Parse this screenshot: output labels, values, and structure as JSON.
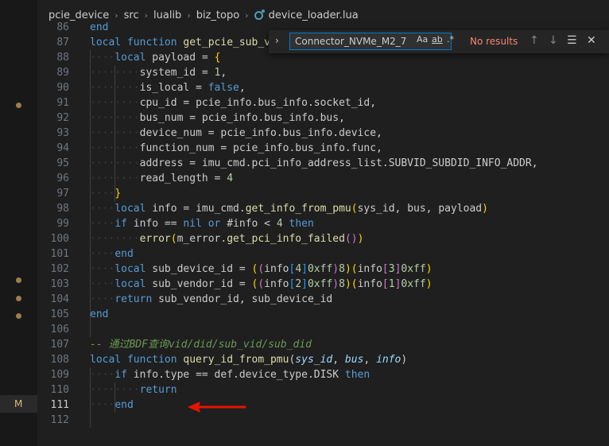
{
  "breadcrumb": {
    "items": [
      "pcie_device",
      "src",
      "lualib",
      "biz_topo",
      "device_loader.lua"
    ],
    "separator": "›"
  },
  "find": {
    "query": "Connector_NVMe_M2_7",
    "match_case_label": "Aa",
    "whole_word_label": "ab",
    "regex_label": ".*",
    "status": "No results",
    "toggle_icon": "chevron-right-icon",
    "prev_icon": "arrow-up-icon",
    "next_icon": "arrow-down-icon",
    "selection_icon": "find-in-selection-icon",
    "close_icon": "close-icon"
  },
  "gutter": {
    "modified_label": "M"
  },
  "lines": [
    {
      "n": "86",
      "tokens": [
        [
          "kw",
          "end"
        ]
      ]
    },
    {
      "n": "87",
      "tokens": [
        [
          "kw",
          "local function "
        ],
        [
          "fn",
          "get_pcie_sub_vid_did_info"
        ],
        [
          "",
          "("
        ],
        [
          "param",
          "sys_id"
        ],
        [
          "",
          ", "
        ],
        [
          "param",
          "bus"
        ],
        [
          "",
          ", "
        ],
        [
          "param",
          "pcie_info"
        ],
        [
          "",
          ")"
        ]
      ]
    },
    {
      "n": "88",
      "tokens": [
        [
          "ws",
          "····"
        ],
        [
          "kw",
          "local "
        ],
        [
          "",
          "payload = "
        ],
        [
          "brace",
          "{"
        ]
      ]
    },
    {
      "n": "89",
      "tokens": [
        [
          "ws",
          "········"
        ],
        [
          "",
          "system_id = "
        ],
        [
          "num",
          "1"
        ],
        [
          "",
          ","
        ]
      ]
    },
    {
      "n": "90",
      "tokens": [
        [
          "ws",
          "········"
        ],
        [
          "",
          "is_local = "
        ],
        [
          "kw",
          "false"
        ],
        [
          "",
          ","
        ]
      ]
    },
    {
      "n": "91",
      "tokens": [
        [
          "ws",
          "········"
        ],
        [
          "",
          "cpu_id = pcie_info.bus_info.socket_id,"
        ]
      ]
    },
    {
      "n": "92",
      "tokens": [
        [
          "ws",
          "········"
        ],
        [
          "",
          "bus_num = pcie_info.bus_info.bus,"
        ]
      ]
    },
    {
      "n": "93",
      "tokens": [
        [
          "ws",
          "········"
        ],
        [
          "",
          "device_num = pcie_info.bus_info.device,"
        ]
      ]
    },
    {
      "n": "94",
      "tokens": [
        [
          "ws",
          "········"
        ],
        [
          "",
          "function_num = pcie_info.bus_info.func,"
        ]
      ]
    },
    {
      "n": "95",
      "tokens": [
        [
          "ws",
          "········"
        ],
        [
          "",
          "address = imu_cmd.pci_info_address_list.SUBVID_SUBDID_INFO_ADDR,"
        ]
      ]
    },
    {
      "n": "96",
      "tokens": [
        [
          "ws",
          "········"
        ],
        [
          "",
          "read_length = "
        ],
        [
          "num",
          "4"
        ]
      ]
    },
    {
      "n": "97",
      "tokens": [
        [
          "ws",
          "····"
        ],
        [
          "brace",
          "}"
        ]
      ]
    },
    {
      "n": "98",
      "tokens": [
        [
          "ws",
          "····"
        ],
        [
          "kw",
          "local "
        ],
        [
          "",
          "info = imu_cmd."
        ],
        [
          "fn",
          "get_info_from_pmu"
        ],
        [
          "brace",
          "("
        ],
        [
          "",
          "sys_id, bus, payload"
        ],
        [
          "brace",
          ")"
        ]
      ]
    },
    {
      "n": "99",
      "tokens": [
        [
          "ws",
          "····"
        ],
        [
          "kw",
          "if "
        ],
        [
          "",
          "info == "
        ],
        [
          "kw",
          "nil or "
        ],
        [
          "",
          "#info < "
        ],
        [
          "num",
          "4"
        ],
        [
          "kw",
          " then"
        ]
      ]
    },
    {
      "n": "100",
      "tokens": [
        [
          "ws",
          "········"
        ],
        [
          "fn",
          "error"
        ],
        [
          "brace",
          "("
        ],
        [
          "",
          "m_error."
        ],
        [
          "fn",
          "get_pci_info_failed"
        ],
        [
          "brace2",
          "()"
        ],
        [
          "brace",
          ")"
        ]
      ]
    },
    {
      "n": "101",
      "tokens": [
        [
          "ws",
          "····"
        ],
        [
          "kw",
          "end"
        ]
      ]
    },
    {
      "n": "102",
      "tokens": [
        [
          "ws",
          "····"
        ],
        [
          "kw",
          "local "
        ],
        [
          "",
          "sub_device_id = "
        ],
        [
          "brace",
          "("
        ],
        [
          "brace2",
          "("
        ],
        [
          "",
          "info"
        ],
        [
          "brace3",
          "["
        ],
        [
          "num",
          "4"
        ],
        [
          "brace3",
          "]"
        ],
        [
          "",
          "",
          " & "
        ],
        [
          "num",
          "0xff"
        ],
        [
          "brace2",
          ")"
        ],
        [
          "",
          "",
          " << "
        ],
        [
          "num",
          "8"
        ],
        [
          "brace",
          ")"
        ],
        [
          "",
          "",
          " + "
        ],
        [
          "brace",
          "("
        ],
        [
          "",
          "info"
        ],
        [
          "brace2",
          "["
        ],
        [
          "num",
          "3"
        ],
        [
          "brace2",
          "]"
        ],
        [
          "",
          "",
          " & "
        ],
        [
          "num",
          "0xff"
        ],
        [
          "brace",
          ")"
        ]
      ]
    },
    {
      "n": "103",
      "tokens": [
        [
          "ws",
          "····"
        ],
        [
          "kw",
          "local "
        ],
        [
          "",
          "sub_vendor_id = "
        ],
        [
          "brace",
          "("
        ],
        [
          "brace2",
          "("
        ],
        [
          "",
          "info"
        ],
        [
          "brace3",
          "["
        ],
        [
          "num",
          "2"
        ],
        [
          "brace3",
          "]"
        ],
        [
          "",
          "",
          " & "
        ],
        [
          "num",
          "0xff"
        ],
        [
          "brace2",
          ")"
        ],
        [
          "",
          "",
          " << "
        ],
        [
          "num",
          "8"
        ],
        [
          "brace",
          ")"
        ],
        [
          "",
          "",
          " + "
        ],
        [
          "brace",
          "("
        ],
        [
          "",
          "info"
        ],
        [
          "brace2",
          "["
        ],
        [
          "num",
          "1"
        ],
        [
          "brace2",
          "]"
        ],
        [
          "",
          "",
          " & "
        ],
        [
          "num",
          "0xff"
        ],
        [
          "brace",
          ")"
        ]
      ]
    },
    {
      "n": "104",
      "tokens": [
        [
          "ws",
          "····"
        ],
        [
          "kw",
          "return "
        ],
        [
          "",
          "sub_vendor_id, sub_device_id"
        ]
      ]
    },
    {
      "n": "105",
      "tokens": [
        [
          "kw",
          "end"
        ]
      ]
    },
    {
      "n": "106",
      "tokens": []
    },
    {
      "n": "107",
      "tokens": [
        [
          "cmt",
          "-- 通过BDF查询vid/did/sub_vid/sub_did"
        ]
      ]
    },
    {
      "n": "108",
      "tokens": [
        [
          "kw",
          "local function "
        ],
        [
          "fn",
          "query_id_from_pmu"
        ],
        [
          "",
          "("
        ],
        [
          "param",
          "sys_id"
        ],
        [
          "",
          ", "
        ],
        [
          "param",
          "bus"
        ],
        [
          "",
          ", "
        ],
        [
          "param",
          "info"
        ],
        [
          "",
          ")"
        ]
      ]
    },
    {
      "n": "109",
      "tokens": [
        [
          "ws",
          "····"
        ],
        [
          "kw",
          "if "
        ],
        [
          "",
          "info.type == def.device_type.DISK "
        ],
        [
          "kw",
          "then"
        ]
      ]
    },
    {
      "n": "110",
      "tokens": [
        [
          "ws",
          "········"
        ],
        [
          "kw",
          "return"
        ]
      ]
    },
    {
      "n": "111",
      "tokens": [
        [
          "ws",
          "····"
        ],
        [
          "kw",
          "end"
        ]
      ]
    },
    {
      "n": "112",
      "tokens": []
    }
  ],
  "current_line": "111",
  "colors": {
    "background": "#1f1f1f",
    "keyword": "#569cd6",
    "function": "#dcdcaa",
    "number": "#b5cea8",
    "comment": "#6a9955",
    "annotation_arrow": "#e51400"
  }
}
